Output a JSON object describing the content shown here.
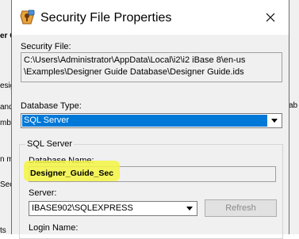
{
  "background": {
    "left_fragments": [
      "er Gu",
      "esig",
      "and",
      "mbe",
      "n m",
      "Sec",
      "ts"
    ],
    "right_fragment": "ab"
  },
  "dialog": {
    "title": "Security File Properties",
    "icon": "security-keys-icon",
    "close_icon": "close-icon"
  },
  "security_file": {
    "label": "Security File:",
    "path_line1": "C:\\Users\\Administrator\\AppData\\Local\\i2\\i2 iBase 8\\en-us",
    "path_line2": "\\Examples\\Designer Guide Database\\Designer Guide.ids"
  },
  "database_type": {
    "label": "Database Type:",
    "value": "SQL Server"
  },
  "sql_server": {
    "group_title": "SQL Server",
    "database_name_label": "Database Name:",
    "database_name_value": "Designer_Guide_Sec",
    "server_label": "Server:",
    "server_value": "IBASE902\\SQLEXPRESS",
    "refresh_label": "Refresh",
    "login_label": "Login Name:"
  },
  "colors": {
    "selection": "#0078d7",
    "highlight": "#f5f542"
  }
}
